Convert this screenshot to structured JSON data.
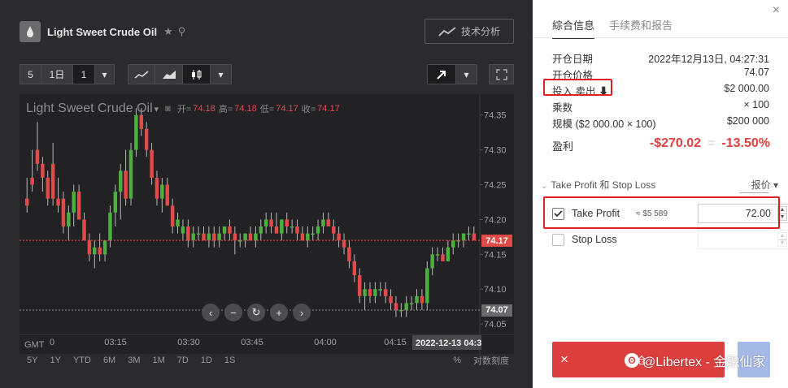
{
  "header": {
    "title": "Light Sweet Crude Oil",
    "tech_analysis_label": "技术分析"
  },
  "toolbar": {
    "btn_5": "5",
    "btn_1d": "1日",
    "btn_1": "1",
    "caret": "▾"
  },
  "chart_data": {
    "type": "candlestick",
    "title": "Light Sweet Crude Oil",
    "ohlc": {
      "open_label": "开=",
      "open": "74.18",
      "high_label": "高=",
      "high": "74.18",
      "low_label": "低=",
      "low": "74.17",
      "close_label": "收=",
      "close": "74.17"
    },
    "x_ticks": [
      "0",
      "03:15",
      "03:30",
      "03:45",
      "04:00",
      "04:15"
    ],
    "x_time_label": "2022-12-13 04:3",
    "gmt_label": "GMT",
    "y_ticks": [
      "74.35",
      "74.30",
      "74.25",
      "74.20",
      "74.15",
      "74.10",
      "74.05"
    ],
    "ylim": [
      74.035,
      74.38
    ],
    "current_price": "74.17",
    "low_price_tag": "74.07",
    "candles": [
      [
        74.23,
        74.26,
        74.21,
        74.22
      ],
      [
        74.26,
        74.3,
        74.24,
        74.25
      ],
      [
        74.3,
        74.34,
        74.27,
        74.28
      ],
      [
        74.28,
        74.29,
        74.24,
        74.26
      ],
      [
        74.26,
        74.27,
        74.22,
        74.23
      ],
      [
        74.28,
        74.31,
        74.22,
        74.23
      ],
      [
        74.23,
        74.26,
        74.21,
        74.22
      ],
      [
        74.23,
        74.24,
        74.18,
        74.19
      ],
      [
        74.19,
        74.22,
        74.17,
        74.21
      ],
      [
        74.21,
        74.25,
        74.19,
        74.24
      ],
      [
        74.24,
        74.25,
        74.2,
        74.2
      ],
      [
        74.2,
        74.21,
        74.17,
        74.17
      ],
      [
        74.17,
        74.18,
        74.14,
        74.15
      ],
      [
        74.15,
        74.17,
        74.13,
        74.16
      ],
      [
        74.16,
        74.18,
        74.14,
        74.15
      ],
      [
        74.15,
        74.17,
        74.14,
        74.17
      ],
      [
        74.17,
        74.22,
        74.16,
        74.21
      ],
      [
        74.21,
        74.25,
        74.19,
        74.24
      ],
      [
        74.24,
        74.28,
        74.2,
        74.27
      ],
      [
        74.27,
        74.3,
        74.22,
        74.23
      ],
      [
        74.23,
        74.31,
        74.22,
        74.3
      ],
      [
        74.3,
        74.36,
        74.29,
        74.35
      ],
      [
        74.35,
        74.36,
        74.32,
        74.33
      ],
      [
        74.33,
        74.34,
        74.29,
        74.3
      ],
      [
        74.3,
        74.31,
        74.25,
        74.26
      ],
      [
        74.26,
        74.27,
        74.22,
        74.23
      ],
      [
        74.23,
        74.26,
        74.21,
        74.25
      ],
      [
        74.25,
        74.26,
        74.22,
        74.22
      ],
      [
        74.22,
        74.23,
        74.18,
        74.19
      ],
      [
        74.19,
        74.21,
        74.18,
        74.2
      ],
      [
        74.18,
        74.2,
        74.17,
        74.19
      ],
      [
        74.19,
        74.2,
        74.16,
        74.17
      ],
      [
        74.17,
        74.19,
        74.16,
        74.18
      ],
      [
        74.18,
        74.19,
        74.17,
        74.18
      ],
      [
        74.18,
        74.19,
        74.17,
        74.17
      ],
      [
        74.17,
        74.19,
        74.16,
        74.18
      ],
      [
        74.18,
        74.19,
        74.16,
        74.17
      ],
      [
        74.17,
        74.19,
        74.16,
        74.18
      ],
      [
        74.18,
        74.19,
        74.17,
        74.19
      ],
      [
        74.19,
        74.2,
        74.17,
        74.18
      ],
      [
        74.18,
        74.19,
        74.15,
        74.17
      ],
      [
        74.17,
        74.18,
        74.16,
        74.17
      ],
      [
        74.17,
        74.18,
        74.16,
        74.18
      ],
      [
        74.18,
        74.19,
        74.17,
        74.17
      ],
      [
        74.17,
        74.19,
        74.16,
        74.18
      ],
      [
        74.18,
        74.2,
        74.17,
        74.19
      ],
      [
        74.19,
        74.21,
        74.18,
        74.2
      ],
      [
        74.2,
        74.21,
        74.18,
        74.19
      ],
      [
        74.19,
        74.21,
        74.18,
        74.18
      ],
      [
        74.18,
        74.2,
        74.17,
        74.2
      ],
      [
        74.2,
        74.21,
        74.18,
        74.19
      ],
      [
        74.19,
        74.2,
        74.18,
        74.19
      ],
      [
        74.19,
        74.2,
        74.17,
        74.18
      ],
      [
        74.18,
        74.19,
        74.17,
        74.17
      ],
      [
        74.17,
        74.19,
        74.16,
        74.18
      ],
      [
        74.18,
        74.19,
        74.17,
        74.18
      ],
      [
        74.18,
        74.2,
        74.17,
        74.19
      ],
      [
        74.19,
        74.21,
        74.18,
        74.2
      ],
      [
        74.2,
        74.21,
        74.19,
        74.19
      ],
      [
        74.19,
        74.2,
        74.17,
        74.18
      ],
      [
        74.18,
        74.19,
        74.16,
        74.17
      ],
      [
        74.17,
        74.18,
        74.15,
        74.16
      ],
      [
        74.16,
        74.17,
        74.13,
        74.14
      ],
      [
        74.14,
        74.15,
        74.11,
        74.12
      ],
      [
        74.12,
        74.13,
        74.08,
        74.09
      ],
      [
        74.09,
        74.11,
        74.07,
        74.1
      ],
      [
        74.1,
        74.11,
        74.08,
        74.09
      ],
      [
        74.09,
        74.11,
        74.08,
        74.1
      ],
      [
        74.1,
        74.11,
        74.09,
        74.1
      ],
      [
        74.1,
        74.11,
        74.08,
        74.09
      ],
      [
        74.09,
        74.1,
        74.07,
        74.08
      ],
      [
        74.08,
        74.09,
        74.06,
        74.07
      ],
      [
        74.07,
        74.08,
        74.06,
        74.07
      ],
      [
        74.07,
        74.09,
        74.06,
        74.08
      ],
      [
        74.08,
        74.09,
        74.07,
        74.08
      ],
      [
        74.08,
        74.1,
        74.07,
        74.09
      ],
      [
        74.09,
        74.1,
        74.07,
        74.08
      ],
      [
        74.08,
        74.14,
        74.07,
        74.13
      ],
      [
        74.13,
        74.16,
        74.12,
        74.15
      ],
      [
        74.15,
        74.16,
        74.14,
        74.15
      ],
      [
        74.15,
        74.16,
        74.14,
        74.14
      ],
      [
        74.14,
        74.17,
        74.14,
        74.16
      ],
      [
        74.16,
        74.18,
        74.15,
        74.17
      ],
      [
        74.17,
        74.18,
        74.16,
        74.17
      ],
      [
        74.17,
        74.18,
        74.16,
        74.18
      ],
      [
        74.18,
        74.19,
        74.17,
        74.18
      ],
      [
        74.18,
        74.19,
        74.17,
        74.17
      ]
    ]
  },
  "chart_nav": {
    "prev": "‹",
    "zoom_out": "−",
    "reset": "↻",
    "zoom_in": "+",
    "next": "›"
  },
  "ranges": [
    "5Y",
    "1Y",
    "YTD",
    "6M",
    "3M",
    "1M",
    "7D",
    "1D",
    "1S"
  ],
  "percent_label": "%",
  "log_label": "对数刻度",
  "panel": {
    "tab_info": "綜合信息",
    "tab_fees": "手续费和报告",
    "close": "×",
    "rows": [
      {
        "label": "开仓日期",
        "value": "2022年12月13日, 04:27:31"
      },
      {
        "label": "开仓价格",
        "value": "74.07"
      },
      {
        "label": "投入 卖出 ⬇",
        "value": "$2 000.00"
      },
      {
        "label": "乘数",
        "value": "× 100"
      },
      {
        "label": "规模 ($2 000.00 × 100)",
        "value": "$200 000"
      }
    ],
    "pnl_label": "盈利",
    "pnl_value": "-$270.02",
    "pnl_eq": "=",
    "pnl_pct": "-13.50%",
    "tpsl_label": "Take Profit 和 Stop Loss",
    "price_dropdown": "报价 ▾",
    "take_profit_label": "Take Profit",
    "take_profit_approx": "≈ $5 589",
    "take_profit_value": "72.00",
    "stop_loss_label": "Stop Loss",
    "sell_close": "×",
    "sell_btn_text": "平仓"
  },
  "watermark": "@Libertex - 金融仙家",
  "colors": {
    "bull": "#4caf3f",
    "bear": "#e24a4a",
    "panel_bg": "#2b2b2d",
    "accent_red": "#dd3f3f"
  }
}
